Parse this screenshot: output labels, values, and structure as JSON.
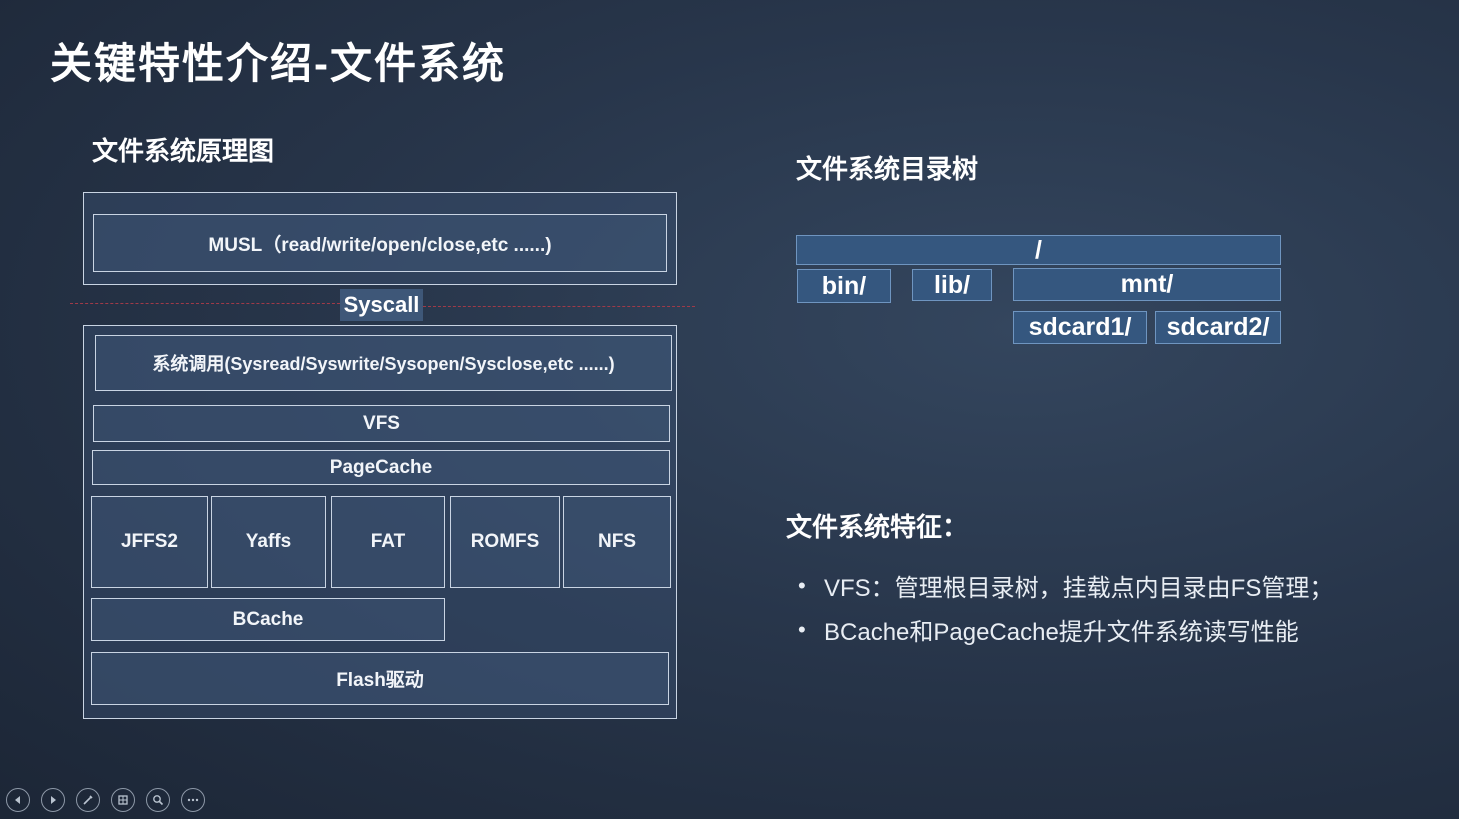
{
  "slide": {
    "title": "关键特性介绍-文件系统",
    "diagram_title": "文件系统原理图",
    "tree_title": "文件系统目录树",
    "features_title": "文件系统特征："
  },
  "diagram": {
    "musl": "MUSL（read/write/open/close,etc ......)",
    "syscall": "Syscall",
    "sys_calls": "系统调用(Sysread/Syswrite/Sysopen/Sysclose,etc ......)",
    "vfs": "VFS",
    "pagecache": "PageCache",
    "fs": [
      "JFFS2",
      "Yaffs",
      "FAT",
      "ROMFS",
      "NFS"
    ],
    "bcache": "BCache",
    "flash": "Flash驱动"
  },
  "tree": {
    "root": "/",
    "bin": "bin/",
    "lib": "lib/",
    "mnt": "mnt/",
    "sdcard1": "sdcard1/",
    "sdcard2": "sdcard2/"
  },
  "features": [
    "VFS：管理根目录树，挂载点内目录由FS管理；",
    "BCache和PageCache提升文件系统读写性能"
  ],
  "controls": [
    "prev-icon",
    "next-icon",
    "pen-icon",
    "slides-icon",
    "zoom-icon",
    "more-icon"
  ]
}
